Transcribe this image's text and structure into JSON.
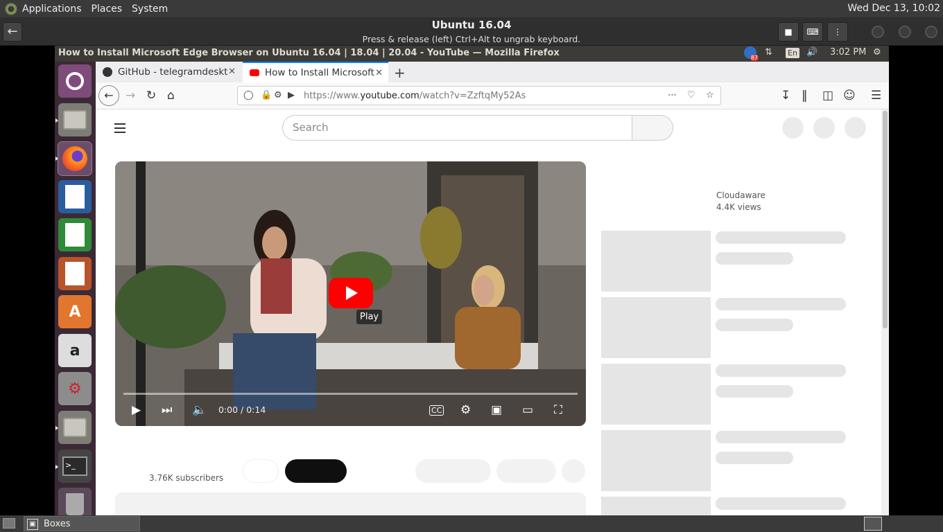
{
  "host_panel": {
    "menus": [
      "Applications",
      "Places",
      "System"
    ],
    "clock": "Wed Dec 13, 10:02"
  },
  "boxes": {
    "title": "Ubuntu 16.04",
    "subtitle": "Press & release (left) Ctrl+Alt to ungrab keyboard."
  },
  "guest": {
    "window_title": "How to Install Microsoft Edge Browser on Ubuntu 16.04 | 18.04 | 20.04 - YouTube — Mozilla Firefox",
    "keyboard_layout": "En",
    "time": "3:02 PM",
    "notification_count": "87"
  },
  "firefox": {
    "tabs": [
      {
        "label": "GitHub - telegramdeskt"
      },
      {
        "label": "How to Install Microsoft"
      }
    ],
    "url_prefix": "https://www.",
    "url_domain": "youtube.com",
    "url_path": "/watch?v=ZzftqMy52As"
  },
  "youtube": {
    "search_placeholder": "Search",
    "time_display": "0:00 / 0:14",
    "tooltip": "Play",
    "side_channel": "Cloudaware",
    "side_views": "4.4K views",
    "subscribers": "3.76K subscribers"
  },
  "host_bottom": {
    "task_label": "Boxes"
  },
  "colors": {
    "youtube_red": "#ff0000",
    "unity_launcher": "#3b2a36",
    "firefox_accent": "#0a84ff"
  }
}
